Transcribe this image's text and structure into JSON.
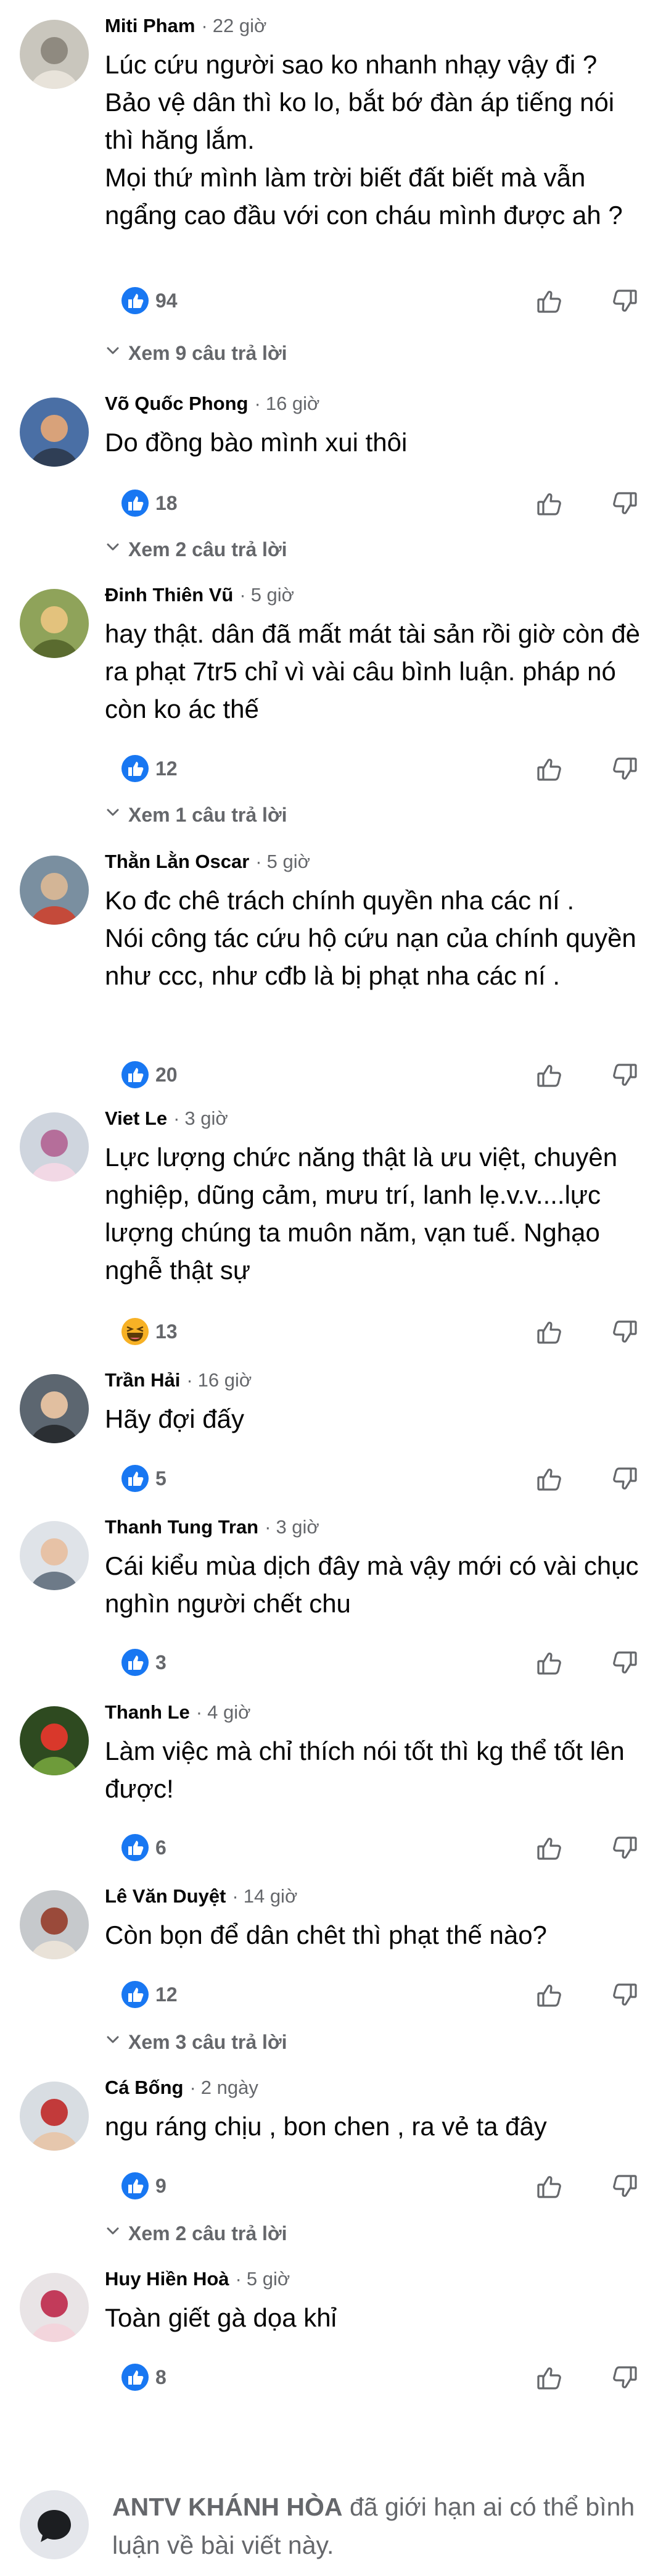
{
  "comments": [
    {
      "author": "Miti Pham",
      "time": "22 giờ",
      "text": "Lúc cứu người sao ko nhanh nhạy vậy đi ?\nBảo vệ dân thì ko lo, bắt bớ đàn áp tiếng nói thì hăng lắm.\nMọi thứ mình làm trời biết đất biết mà vẫn ngẩng cao đầu với con cháu mình được ah ?",
      "reaction": "like",
      "count": "94",
      "replies": "Xem 9 câu trả lời"
    },
    {
      "author": "Võ Quốc Phong",
      "time": "16 giờ",
      "text": "Do đồng bào mình xui thôi",
      "reaction": "like",
      "count": "18",
      "replies": "Xem 2 câu trả lời"
    },
    {
      "author": "Đinh Thiên Vũ",
      "time": "5 giờ",
      "text": "hay thật. dân đã mất mát tài sản rồi giờ còn đè ra phạt 7tr5 chỉ vì vài câu bình luận. pháp nó còn ko ác thế",
      "reaction": "like",
      "count": "12",
      "replies": "Xem 1 câu trả lời"
    },
    {
      "author": "Thằn Lằn Oscar",
      "time": "5 giờ",
      "text": "Ko đc chê trách chính quyền nha các ní .\nNói công tác cứu hộ cứu nạn của chính quyền như ccc, như cđb  là bị phạt nha các ní .",
      "reaction": "like",
      "count": "20",
      "replies": ""
    },
    {
      "author": "Viet Le",
      "time": "3 giờ",
      "text": "Lực lượng chức năng thật là ưu việt, chuyên nghiệp, dũng cảm, mưu trí, lanh lẹ.v.v....lực lượng chúng ta muôn năm, vạn tuế. Nghạo nghễ thật sự",
      "reaction": "haha",
      "count": "13",
      "replies": ""
    },
    {
      "author": "Trần Hải",
      "time": "16 giờ",
      "text": "Hãy đợi đấy",
      "reaction": "like",
      "count": "5",
      "replies": ""
    },
    {
      "author": "Thanh Tung Tran",
      "time": "3 giờ",
      "text": "Cái kiểu mùa dịch đây mà vậy mới có vài chục nghìn người chết chu",
      "reaction": "like",
      "count": "3",
      "replies": ""
    },
    {
      "author": "Thanh Le",
      "time": "4 giờ",
      "text": "Làm việc mà chỉ thích nói tốt thì kg thể tốt lên được!",
      "reaction": "like",
      "count": "6",
      "replies": ""
    },
    {
      "author": "Lê Văn Duyệt",
      "time": "14 giờ",
      "text": "Còn bọn để dân chêt thì phạt thế nào?",
      "reaction": "like",
      "count": "12",
      "replies": "Xem 3 câu trả lời"
    },
    {
      "author": "Cá Bống",
      "time": "2 ngày",
      "text": "ngu ráng chịu , bon chen , ra vẻ ta đây",
      "reaction": "like",
      "count": "9",
      "replies": "Xem 2 câu trả lời"
    },
    {
      "author": "Huy Hiền Hoà",
      "time": "5 giờ",
      "text": "Toàn giết gà dọa khỉ",
      "reaction": "like",
      "count": "8",
      "replies": ""
    }
  ],
  "footer": {
    "page_name": "ANTV KHÁNH HÒA",
    "message": "đã giới hạn ai có thể bình luận về bài viết này."
  },
  "icons": {
    "like_reaction": "like-reaction-icon",
    "haha_reaction": "haha-reaction-icon",
    "like_button": "thumbs-up-icon",
    "dislike_button": "thumbs-down-icon",
    "replies": "chevron-down-icon",
    "comment_limited": "speech-bubble-icon"
  },
  "colors": {
    "like_blue": "#1877f2",
    "haha_yellow": "#f7b125",
    "secondary_text": "#65676b",
    "primary_text": "#050505"
  }
}
